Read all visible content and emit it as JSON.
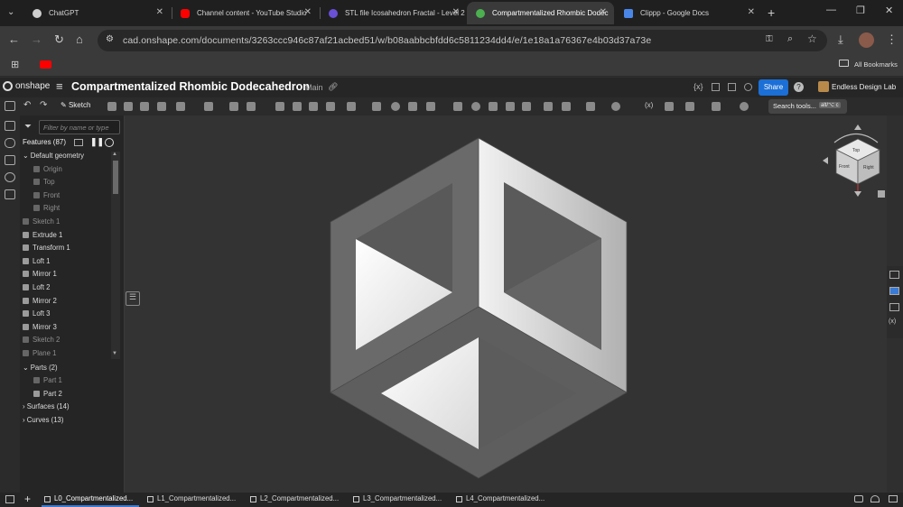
{
  "browser": {
    "tabs": [
      {
        "title": "ChatGPT",
        "color": "#cfcfcf"
      },
      {
        "title": "Channel content - YouTube Studio",
        "color": "#ff0000"
      },
      {
        "title": "STL file Icosahedron Fractal - Level 2",
        "color": "#6a4fd8"
      },
      {
        "title": "Compartmentalized Rhombic Dodec",
        "color": "#4caf50"
      },
      {
        "title": "Clippp - Google Docs",
        "color": "#4a86e8"
      }
    ],
    "url": "cad.onshape.com/documents/3263ccc946c87af21acbed51/w/b08aabbcbfdd6c5811234dd4/e/1e18a1a76367e4b03d37a73e",
    "bookmarks_label": "All Bookmarks"
  },
  "onshape": {
    "logo": "onshape",
    "doc_title": "Compartmentalized Rhombic Dodecahedron",
    "branch": "Main",
    "share": "Share",
    "workspace": "Endless Design Lab",
    "search_tools": "Search tools...",
    "search_shortcut": "alt/⌥ c",
    "sketch_label": "Sketch"
  },
  "features": {
    "filter_placeholder": "Filter by name or type",
    "count_label": "Features (87)",
    "items": [
      {
        "label": "Default geometry",
        "indent": 0,
        "dim": false,
        "caret": "v"
      },
      {
        "label": "Origin",
        "indent": 1,
        "dim": true
      },
      {
        "label": "Top",
        "indent": 1,
        "dim": true
      },
      {
        "label": "Front",
        "indent": 1,
        "dim": true
      },
      {
        "label": "Right",
        "indent": 1,
        "dim": true
      },
      {
        "label": "Sketch 1",
        "indent": 0,
        "dim": true
      },
      {
        "label": "Extrude 1",
        "indent": 0,
        "dim": false
      },
      {
        "label": "Transform 1",
        "indent": 0,
        "dim": false
      },
      {
        "label": "Loft 1",
        "indent": 0,
        "dim": false
      },
      {
        "label": "Mirror 1",
        "indent": 0,
        "dim": false
      },
      {
        "label": "Loft 2",
        "indent": 0,
        "dim": false
      },
      {
        "label": "Mirror 2",
        "indent": 0,
        "dim": false
      },
      {
        "label": "Loft 3",
        "indent": 0,
        "dim": false
      },
      {
        "label": "Mirror 3",
        "indent": 0,
        "dim": false
      },
      {
        "label": "Sketch 2",
        "indent": 0,
        "dim": true
      },
      {
        "label": "Plane 1",
        "indent": 0,
        "dim": true
      }
    ],
    "parts_label": "Parts (2)",
    "parts": [
      "Part 1",
      "Part 2"
    ],
    "surfaces_label": "Surfaces (14)",
    "curves_label": "Curves (13)"
  },
  "bottom_tabs": [
    "L0_Compartmentalized...",
    "L1_Compartmentalized...",
    "L2_Compartmentalized...",
    "L3_Compartmentalized...",
    "L4_Compartmentalized..."
  ],
  "viewcube": {
    "faces": [
      "Top",
      "Front",
      "Right"
    ]
  }
}
